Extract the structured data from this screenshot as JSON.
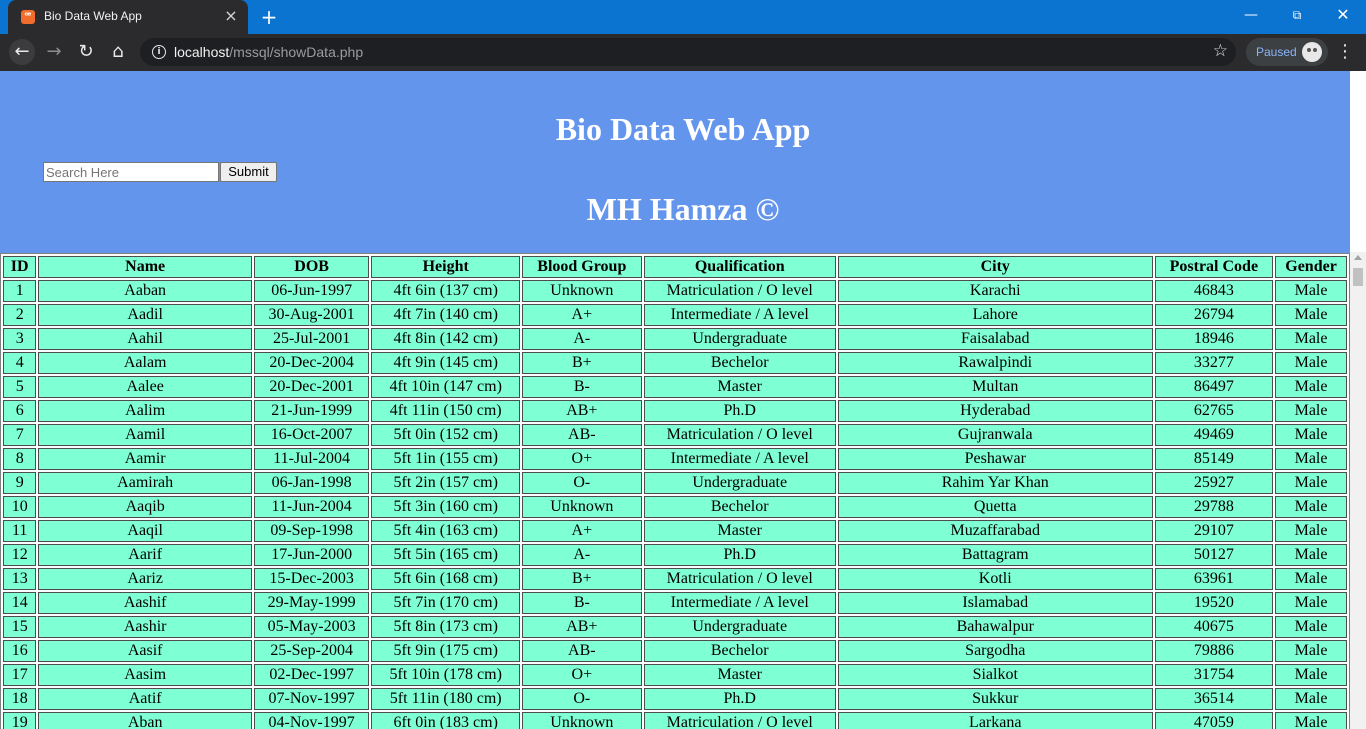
{
  "browser": {
    "tab_title": "Bio Data Web App",
    "new_tab_icon": "plus-icon",
    "url_host": "localhost",
    "url_path": "/mssql/showData.php",
    "profile_status": "Paused"
  },
  "header": {
    "title": "Bio Data Web App",
    "author": "MH Hamza ©",
    "background": "#6495ed"
  },
  "search": {
    "placeholder": "Search Here",
    "value": "",
    "submit_label": "Submit"
  },
  "table": {
    "cell_background": "#7fffd4",
    "columns": [
      "ID",
      "Name",
      "DOB",
      "Height",
      "Blood Group",
      "Qualification",
      "City",
      "Postral Code",
      "Gender"
    ],
    "rows": [
      [
        "1",
        "Aaban",
        "06-Jun-1997",
        "4ft 6in (137 cm)",
        "Unknown",
        "Matriculation / O level",
        "Karachi",
        "46843",
        "Male"
      ],
      [
        "2",
        "Aadil",
        "30-Aug-2001",
        "4ft 7in (140 cm)",
        "A+",
        "Intermediate / A level",
        "Lahore",
        "26794",
        "Male"
      ],
      [
        "3",
        "Aahil",
        "25-Jul-2001",
        "4ft 8in (142 cm)",
        "A-",
        "Undergraduate",
        "Faisalabad",
        "18946",
        "Male"
      ],
      [
        "4",
        "Aalam",
        "20-Dec-2004",
        "4ft 9in (145 cm)",
        "B+",
        "Bechelor",
        "Rawalpindi",
        "33277",
        "Male"
      ],
      [
        "5",
        "Aalee",
        "20-Dec-2001",
        "4ft 10in (147 cm)",
        "B-",
        "Master",
        "Multan",
        "86497",
        "Male"
      ],
      [
        "6",
        "Aalim",
        "21-Jun-1999",
        "4ft 11in (150 cm)",
        "AB+",
        "Ph.D",
        "Hyderabad",
        "62765",
        "Male"
      ],
      [
        "7",
        "Aamil",
        "16-Oct-2007",
        "5ft 0in (152 cm)",
        "AB-",
        "Matriculation / O level",
        "Gujranwala",
        "49469",
        "Male"
      ],
      [
        "8",
        "Aamir",
        "11-Jul-2004",
        "5ft 1in (155 cm)",
        "O+",
        "Intermediate / A level",
        "Peshawar",
        "85149",
        "Male"
      ],
      [
        "9",
        "Aamirah",
        "06-Jan-1998",
        "5ft 2in (157 cm)",
        "O-",
        "Undergraduate",
        "Rahim Yar Khan",
        "25927",
        "Male"
      ],
      [
        "10",
        "Aaqib",
        "11-Jun-2004",
        "5ft 3in (160 cm)",
        "Unknown",
        "Bechelor",
        "Quetta",
        "29788",
        "Male"
      ],
      [
        "11",
        "Aaqil",
        "09-Sep-1998",
        "5ft 4in (163 cm)",
        "A+",
        "Master",
        "Muzaffarabad",
        "29107",
        "Male"
      ],
      [
        "12",
        "Aarif",
        "17-Jun-2000",
        "5ft 5in (165 cm)",
        "A-",
        "Ph.D",
        "Battagram",
        "50127",
        "Male"
      ],
      [
        "13",
        "Aariz",
        "15-Dec-2003",
        "5ft 6in (168 cm)",
        "B+",
        "Matriculation / O level",
        "Kotli",
        "63961",
        "Male"
      ],
      [
        "14",
        "Aashif",
        "29-May-1999",
        "5ft 7in (170 cm)",
        "B-",
        "Intermediate / A level",
        "Islamabad",
        "19520",
        "Male"
      ],
      [
        "15",
        "Aashir",
        "05-May-2003",
        "5ft 8in (173 cm)",
        "AB+",
        "Undergraduate",
        "Bahawalpur",
        "40675",
        "Male"
      ],
      [
        "16",
        "Aasif",
        "25-Sep-2004",
        "5ft 9in (175 cm)",
        "AB-",
        "Bechelor",
        "Sargodha",
        "79886",
        "Male"
      ],
      [
        "17",
        "Aasim",
        "02-Dec-1997",
        "5ft 10in (178 cm)",
        "O+",
        "Master",
        "Sialkot",
        "31754",
        "Male"
      ],
      [
        "18",
        "Aatif",
        "07-Nov-1997",
        "5ft 11in (180 cm)",
        "O-",
        "Ph.D",
        "Sukkur",
        "36514",
        "Male"
      ],
      [
        "19",
        "Aban",
        "04-Nov-1997",
        "6ft 0in (183 cm)",
        "Unknown",
        "Matriculation / O level",
        "Larkana",
        "47059",
        "Male"
      ]
    ]
  }
}
